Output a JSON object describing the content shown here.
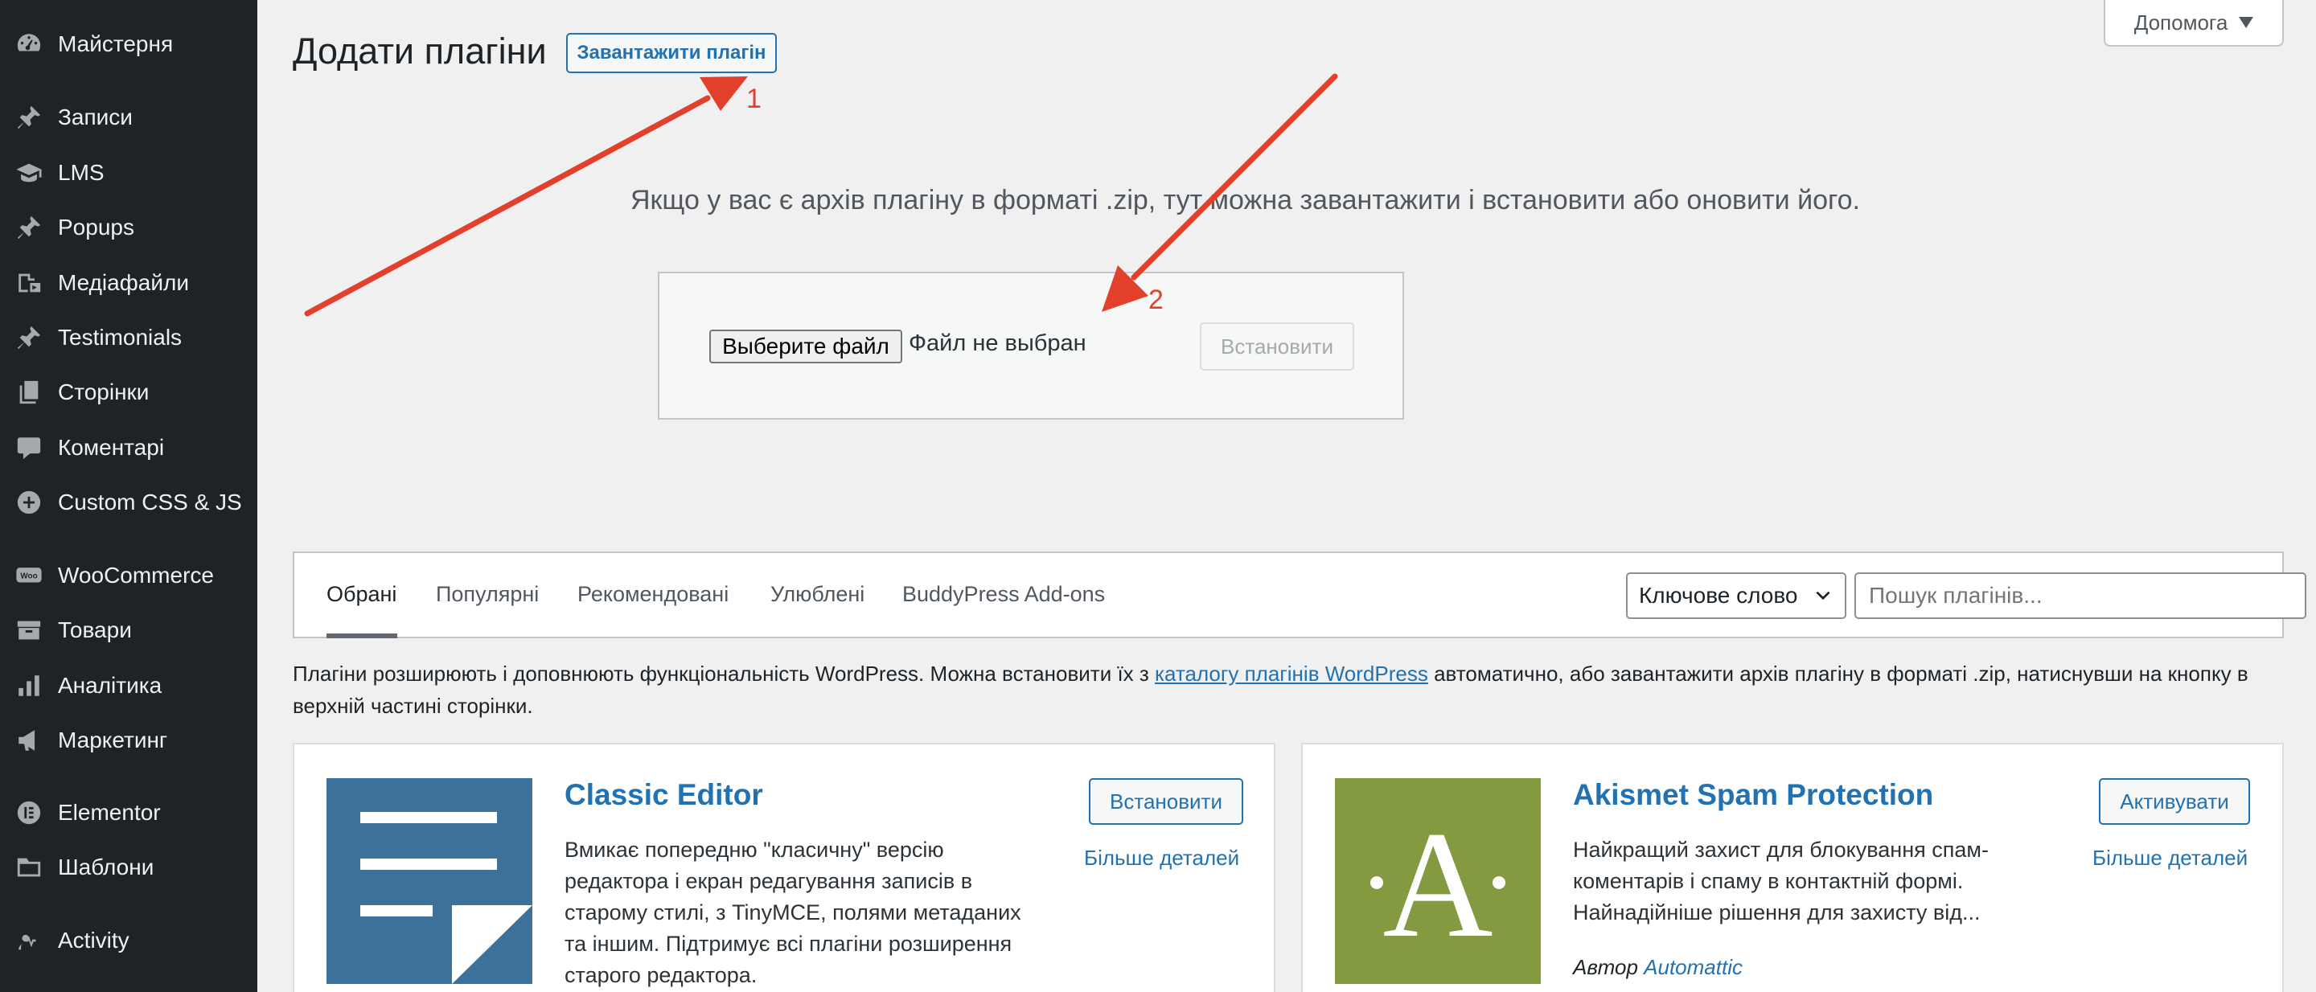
{
  "sidebar": {
    "items": [
      {
        "label": "Майстерня",
        "icon": "dashboard-icon"
      },
      {
        "label": "Записи",
        "icon": "pin-icon"
      },
      {
        "label": "LMS",
        "icon": "graduation-cap-icon"
      },
      {
        "label": "Popups",
        "icon": "pin-icon"
      },
      {
        "label": "Медіафайли",
        "icon": "media-icon"
      },
      {
        "label": "Testimonials",
        "icon": "pin-icon"
      },
      {
        "label": "Сторінки",
        "icon": "pages-icon"
      },
      {
        "label": "Коментарі",
        "icon": "comment-icon"
      },
      {
        "label": "Custom CSS & JS",
        "icon": "plus-circle-icon"
      },
      {
        "label": "WooCommerce",
        "icon": "woo-icon"
      },
      {
        "label": "Товари",
        "icon": "archive-icon"
      },
      {
        "label": "Аналітика",
        "icon": "bar-chart-icon"
      },
      {
        "label": "Маркетинг",
        "icon": "megaphone-icon"
      },
      {
        "label": "Elementor",
        "icon": "elementor-icon"
      },
      {
        "label": "Шаблони",
        "icon": "folder-icon"
      },
      {
        "label": "Activity",
        "icon": "activity-icon"
      }
    ]
  },
  "header": {
    "title": "Додати плагіни",
    "upload_label": "Завантажити плагін",
    "help_label": "Допомога"
  },
  "upload": {
    "text": "Якщо у вас є архів плагіну в форматі .zip, тут можна завантажити і встановити або оновити його.",
    "choose_file": "Выберите файл",
    "no_file": "Файл не выбран",
    "install": "Встановити"
  },
  "filter": {
    "tabs": [
      "Обрані",
      "Популярні",
      "Рекомендовані",
      "Улюблені",
      "BuddyPress Add-ons"
    ],
    "search_type": "Ключове слово",
    "search_placeholder": "Пошук плагінів..."
  },
  "intro": {
    "before": "Плагіни розширюють і доповнюють функціональність WordPress. Можна встановити їх з ",
    "link": "каталогу плагінів WordPress",
    "after": " автоматично, або завантажити архів плагіну в форматі .zip, натиснувши на кнопку в верхній частині сторінки."
  },
  "cards": [
    {
      "name": "Classic Editor",
      "description": "Вмикає попередню \"класичну\" версію редактора і екран редагування записів в старому стилі, з TinyMCE, полями метаданих та іншим. Підтримує всі плагіни розширення старого редактора.",
      "action": "Встановити",
      "more": "Більше деталей",
      "icon_color": "#3c719c"
    },
    {
      "name": "Akismet Spam Protection",
      "description": "Найкращий захист для блокування спам-коментарів і спаму в контактній формі. Найнадійніше рішення для захисту від...",
      "action": "Активувати",
      "more": "Більше деталей",
      "author_prefix": "Автор",
      "author": "Automattic",
      "icon_color": "#839a41",
      "icon_letter": "·A·"
    }
  ],
  "annotations": {
    "one": "1",
    "two": "2",
    "color": "#e2402a"
  }
}
